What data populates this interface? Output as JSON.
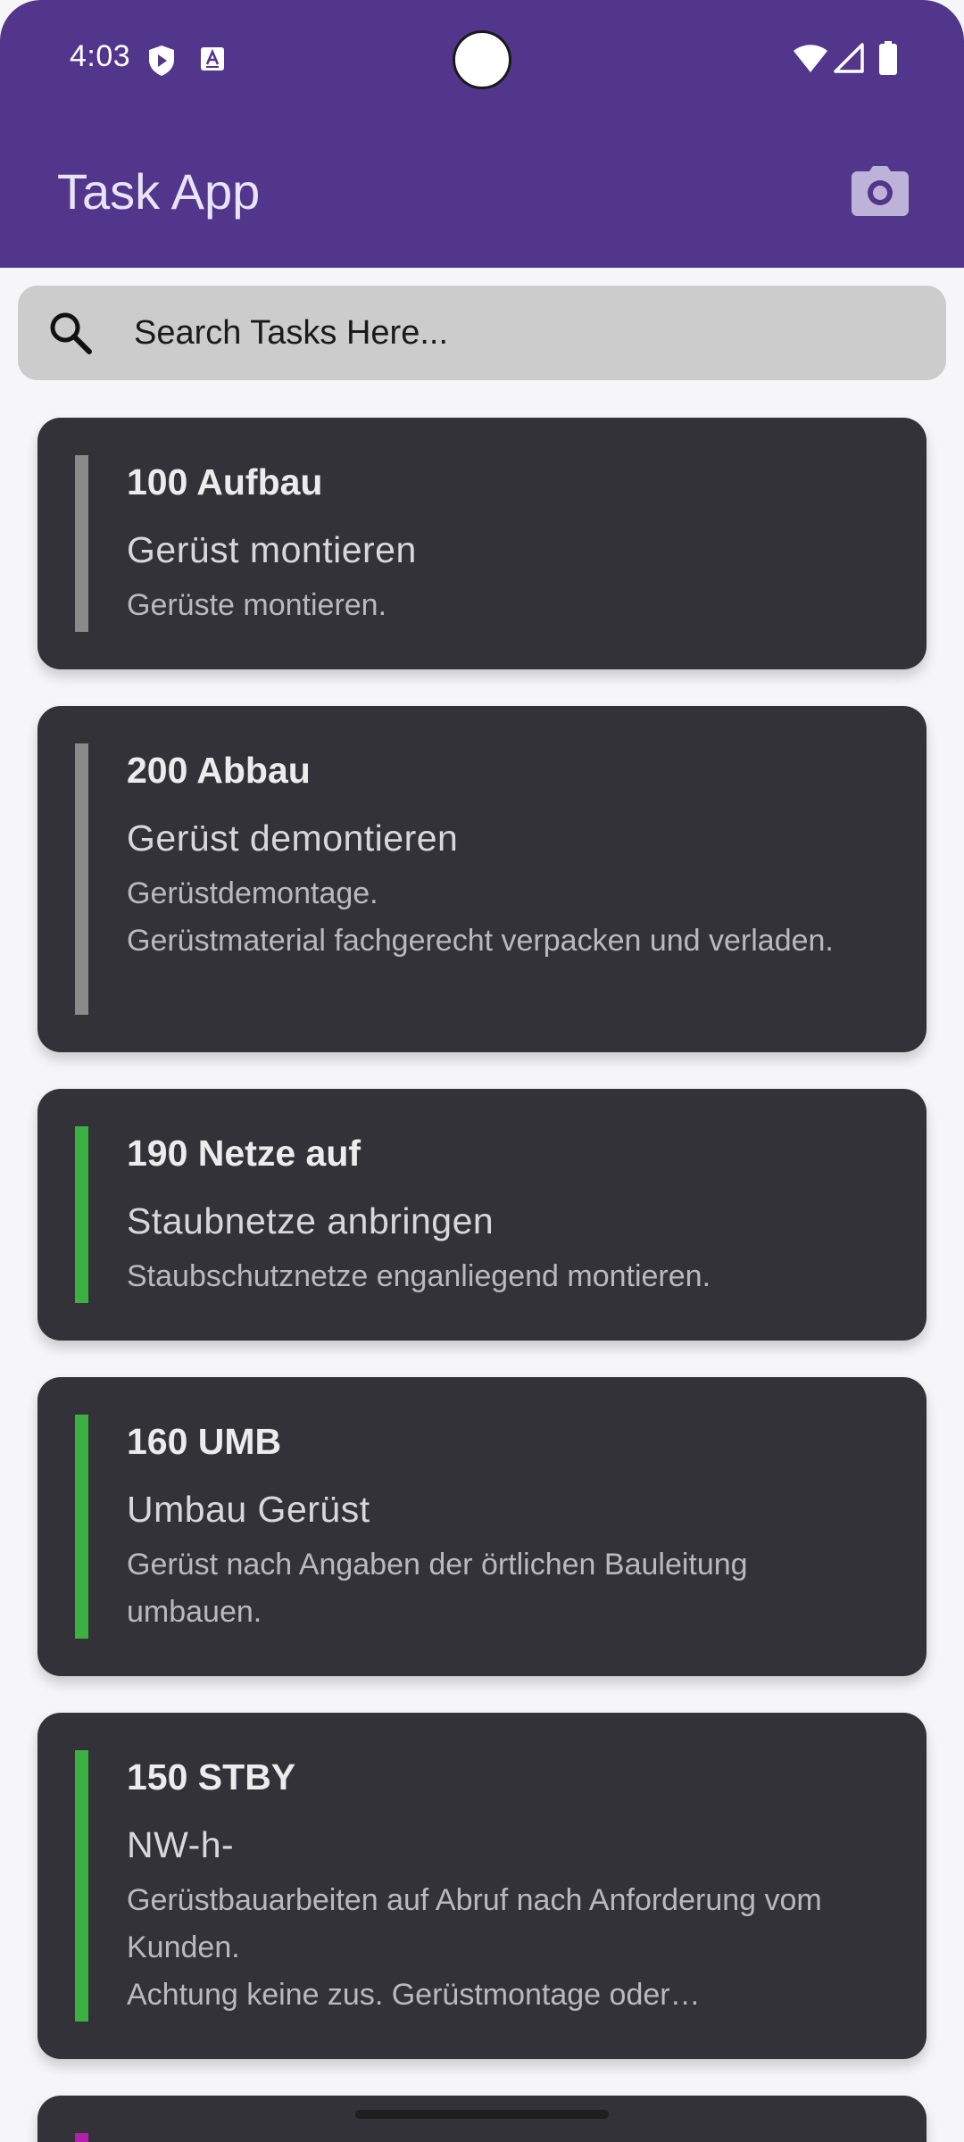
{
  "status_bar": {
    "time": "4:03"
  },
  "app_bar": {
    "title": "Task App",
    "action_icon": "camera-icon",
    "color": "#51368c"
  },
  "search": {
    "placeholder": "Search Tasks Here...",
    "value": "",
    "icon": "search-icon"
  },
  "tasks": [
    {
      "title": "100 Aufbau",
      "subtitle": "Gerüst montieren",
      "description": "Gerüste montieren.",
      "bar_color": "#8a8a8a"
    },
    {
      "title": "200 Abbau",
      "subtitle": "Gerüst demontieren",
      "description": "Gerüstdemontage.\nGerüstmaterial fachgerecht verpacken und verladen.",
      "bar_color": "#8a8a8a"
    },
    {
      "title": "190 Netze auf",
      "subtitle": "Staubnetze anbringen",
      "description": "Staubschutznetze enganliegend montieren.",
      "bar_color": "#3cb043"
    },
    {
      "title": "160 UMB",
      "subtitle": "Umbau Gerüst",
      "description": "Gerüst nach Angaben der örtlichen Bauleitung umbauen.",
      "bar_color": "#3cb043"
    },
    {
      "title": "150 STBY",
      "subtitle": "NW-h-",
      "description": "Gerüstbauarbeiten auf Abruf nach Anforderung vom Kunden.\nAchtung keine zus. Gerüstmontage oder Gerüstdemontage.",
      "bar_color": "#3cb043"
    },
    {
      "title": "",
      "subtitle": "",
      "description": "",
      "bar_color": "#b01fb0"
    }
  ]
}
